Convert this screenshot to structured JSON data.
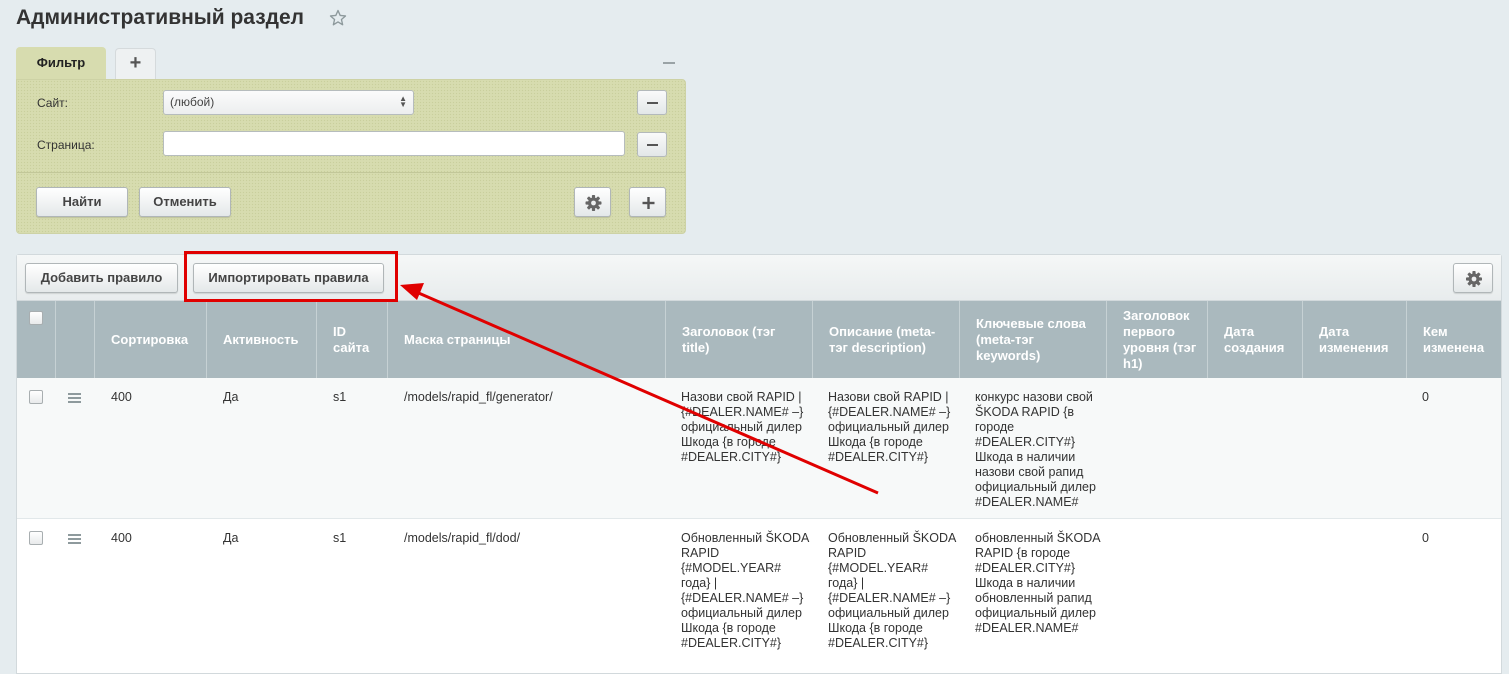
{
  "page": {
    "title": "Административный раздел"
  },
  "filter": {
    "tab_label": "Фильтр",
    "add_tab_label": "+",
    "site_label": "Сайт:",
    "site_value": "(любой)",
    "page_label": "Страница:",
    "page_value": "",
    "find_button": "Найти",
    "cancel_button": "Отменить"
  },
  "toolbar": {
    "add_rule_button": "Добавить правило",
    "import_rules_button": "Импортировать правила"
  },
  "table": {
    "columns": [
      "Сортировка",
      "Активность",
      "ID сайта",
      "Маска страницы",
      "Заголовок (тэг title)",
      "Описание (meta-тэг description)",
      "Ключевые слова (meta-тэг keywords)",
      "Заголовок первого уровня (тэг h1)",
      "Дата создания",
      "Дата изменения",
      "Кем изменена"
    ],
    "rows": [
      {
        "sort": "400",
        "active": "Да",
        "site_id": "s1",
        "mask": "/models/rapid_fl/generator/",
        "title": "Назови свой RAPID | {#DEALER.NAME# –} официальный дилер Шкода {в городе #DEALER.CITY#}",
        "description": "Назови свой RAPID | {#DEALER.NAME# –} официальный дилер Шкода {в городе #DEALER.CITY#}",
        "keywords": "конкурс назови свой ŠKODA RAPID {в городе #DEALER.CITY#} Шкода в наличии назови свой рапид официальный дилер #DEALER.NAME#",
        "h1": "",
        "created": "",
        "modified": "",
        "modified_by": "0"
      },
      {
        "sort": "400",
        "active": "Да",
        "site_id": "s1",
        "mask": "/models/rapid_fl/dod/",
        "title": "Обновленный ŠKODA RAPID {#MODEL.YEAR# года} | {#DEALER.NAME# –} официальный дилер Шкода {в городе #DEALER.CITY#}",
        "description": "Обновленный ŠKODA RAPID {#MODEL.YEAR# года} | {#DEALER.NAME# –} официальный дилер Шкода {в городе #DEALER.CITY#}",
        "keywords": "обновленный ŠKODA RAPID {в городе #DEALER.CITY#} Шкода в наличии обновленный рапид официальный дилер #DEALER.NAME#",
        "h1": "",
        "created": "",
        "modified": "",
        "modified_by": "0"
      }
    ]
  },
  "icons": {
    "star": "star-icon",
    "gear": "gear-icon",
    "plus": "plus-icon",
    "minus": "minus-icon",
    "drag": "drag-handle-icon"
  },
  "colors": {
    "filter_bg": "#d7dcaf",
    "header_bg": "#aab9be",
    "annotation": "#e00000"
  }
}
